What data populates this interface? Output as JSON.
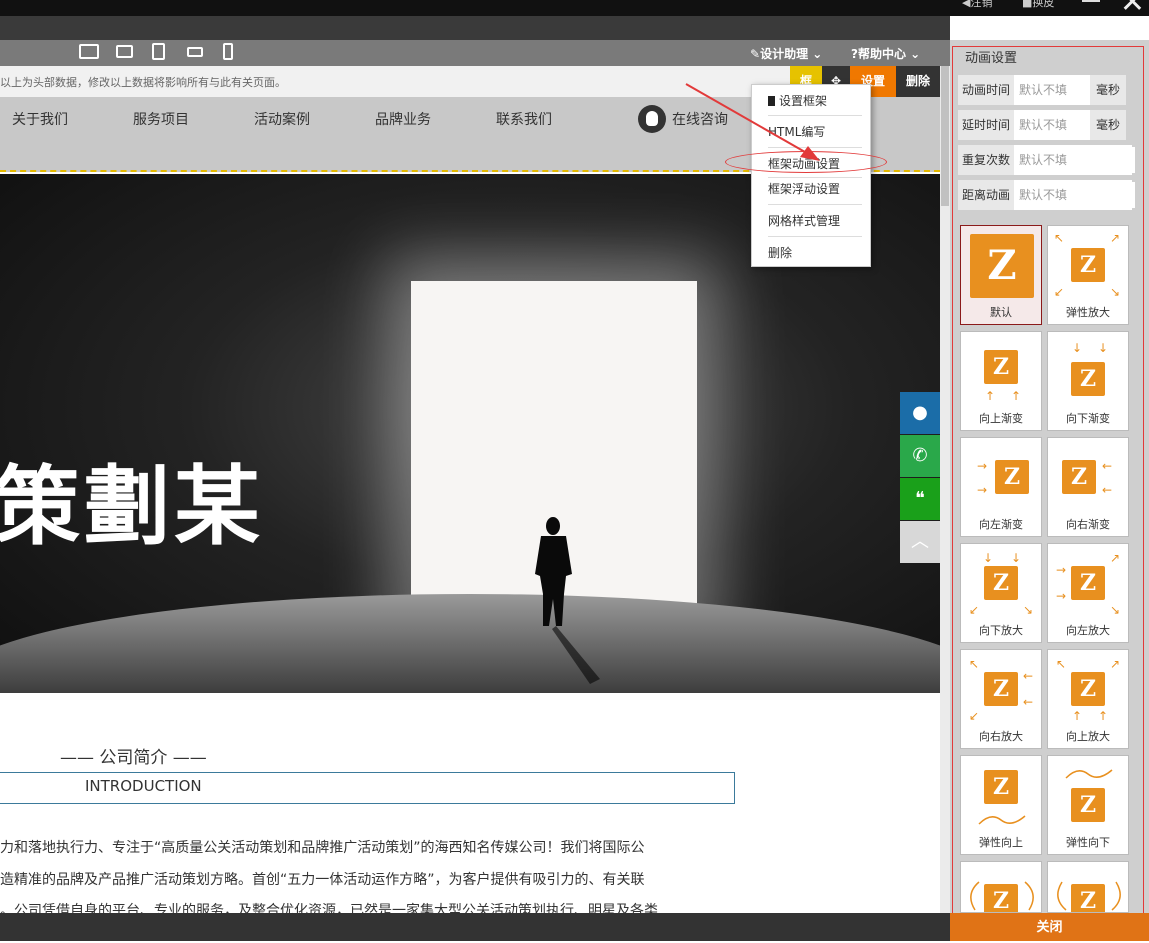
{
  "window": {
    "top_items": [
      "注销",
      "换皮"
    ]
  },
  "toolbar": {
    "devices": [
      "desktop-icon",
      "tablet-landscape-icon",
      "tablet-icon",
      "phone-landscape-icon",
      "phone-icon"
    ],
    "design_helper": "设计助理",
    "help_center": "帮助中心"
  },
  "notice": {
    "message": "以上为头部数据，修改以上数据将影响所有与此有关页面。",
    "buttons": {
      "frame": "框",
      "settings": "设置",
      "delete": "删除"
    }
  },
  "nav": {
    "items": [
      "关于我们",
      "服务项目",
      "活动案例",
      "品牌业务",
      "联系我们"
    ],
    "online": "在线咨询"
  },
  "hero": {
    "calligraphy": "策劃某"
  },
  "context_menu": {
    "items": [
      "设置框架",
      "HTML编写",
      "框架动画设置",
      "框架浮动设置",
      "网格样式管理",
      "删除"
    ]
  },
  "content": {
    "section_title": "—— 公司简介 ——",
    "section_subtitle": "INTRODUCTION",
    "paragraph_lines": [
      "力和落地执行力、专注于“高质量公关活动策划和品牌推广活动策划”的海西知名传媒公司！我们将国际公",
      "造精准的品牌及产品推广活动策划方略。首创“五力一体活动运作方略”，为客户提供有吸引力的、有关联",
      "。公司凭借自身的平台、专业的服务，及整合优化资源，已然是一家集大型公关活动策划执行、明星及各类"
    ]
  },
  "panel": {
    "title": "动画设置",
    "fields": [
      {
        "label": "动画时间",
        "placeholder": "默认不填",
        "unit": "毫秒"
      },
      {
        "label": "延时时间",
        "placeholder": "默认不填",
        "unit": "毫秒"
      },
      {
        "label": "重复次数",
        "placeholder": "默认不填",
        "unit": ""
      },
      {
        "label": "距离动画",
        "placeholder": "默认不填",
        "unit": ""
      }
    ],
    "animations": [
      "默认",
      "弹性放大",
      "向上渐变",
      "向下渐变",
      "向左渐变",
      "向右渐变",
      "向下放大",
      "向左放大",
      "向右放大",
      "向上放大",
      "弹性向上",
      "弹性向下",
      "",
      ""
    ],
    "selected_animation": "默认",
    "close": "关闭"
  },
  "colors": {
    "accent_orange": "#e8901f",
    "settings_orange": "#f07800",
    "frame_yellow": "#e6c200",
    "annotation_red": "#e23a3a",
    "qq_blue": "#1b6da8",
    "phone_green": "#2aa84a",
    "wechat_green": "#1aa01a"
  }
}
